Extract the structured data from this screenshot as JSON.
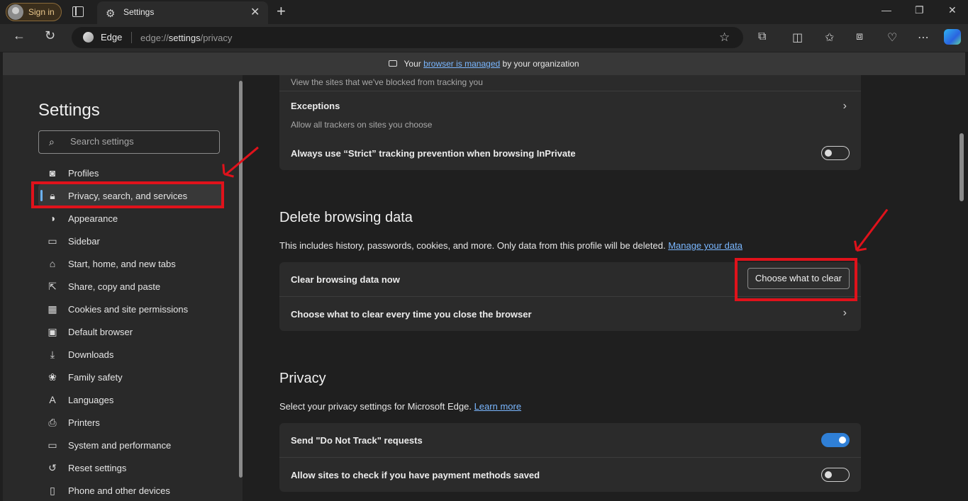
{
  "browser": {
    "signin_label": "Sign in",
    "tab_title": "Settings",
    "address_brand": "Edge",
    "url_prefix": "edge://",
    "url_bold": "settings",
    "url_suffix": "/privacy"
  },
  "banner": {
    "pre": "Your",
    "link": "browser is managed",
    "post": "by your organization"
  },
  "sidebar": {
    "title": "Settings",
    "search_placeholder": "Search settings",
    "items": [
      {
        "label": "Profiles",
        "icon": "person-icon"
      },
      {
        "label": "Privacy, search, and services",
        "icon": "lock-icon"
      },
      {
        "label": "Appearance",
        "icon": "palette-icon"
      },
      {
        "label": "Sidebar",
        "icon": "sidebar-icon"
      },
      {
        "label": "Start, home, and new tabs",
        "icon": "home-icon"
      },
      {
        "label": "Share, copy and paste",
        "icon": "share-icon"
      },
      {
        "label": "Cookies and site permissions",
        "icon": "cookie-icon"
      },
      {
        "label": "Default browser",
        "icon": "browser-icon"
      },
      {
        "label": "Downloads",
        "icon": "download-icon"
      },
      {
        "label": "Family safety",
        "icon": "family-icon"
      },
      {
        "label": "Languages",
        "icon": "language-icon"
      },
      {
        "label": "Printers",
        "icon": "printer-icon"
      },
      {
        "label": "System and performance",
        "icon": "laptop-icon"
      },
      {
        "label": "Reset settings",
        "icon": "reset-icon"
      },
      {
        "label": "Phone and other devices",
        "icon": "phone-icon"
      }
    ]
  },
  "tracking": {
    "blocked_sub": "View the sites that we've blocked from tracking you",
    "exceptions_label": "Exceptions",
    "exceptions_sub": "Allow all trackers on sites you choose",
    "strict_label": "Always use “Strict” tracking prevention when browsing InPrivate"
  },
  "delete_data": {
    "heading": "Delete browsing data",
    "desc": "This includes history, passwords, cookies, and more. Only data from this profile will be deleted.",
    "desc_link": "Manage your data",
    "clear_now_label": "Clear browsing data now",
    "choose_button": "Choose what to clear",
    "on_close_label": "Choose what to clear every time you close the browser"
  },
  "privacy": {
    "heading": "Privacy",
    "desc": "Select your privacy settings for Microsoft Edge.",
    "desc_link": "Learn more",
    "dnt_label": "Send \"Do Not Track\" requests",
    "payment_label": "Allow sites to check if you have payment methods saved"
  },
  "toggles": {
    "strict_inprivate": false,
    "do_not_track": true,
    "payment_methods": false
  },
  "colors": {
    "accent": "#2f7fd6",
    "link": "#7ab7ff",
    "annotation": "#e0121b"
  }
}
